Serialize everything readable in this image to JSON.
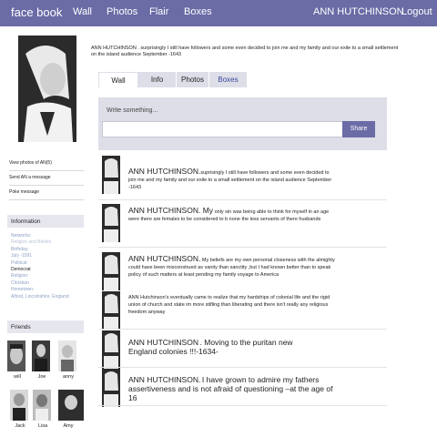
{
  "nav": {
    "brand": "face book",
    "wall": "Wall",
    "photos": "Photos",
    "flair": "Flair",
    "boxes": "Boxes",
    "user": "ANN HUTCHINSON",
    "logout": "Logout"
  },
  "header_text": "ANN HUTCHINSON . surprisingly I still have followers and some even decided to join me and my family and our exile to a small settlement  on the island  audience  September -1643",
  "tabs": [
    "Wall",
    "Info",
    "Photos",
    "Boxes"
  ],
  "composer": {
    "placeholder": "Write something...",
    "share": "Share"
  },
  "left_links": [
    "View photos of AN(5)",
    "Send AN a message",
    "Poke message"
  ],
  "info": {
    "title": "Information",
    "lines": [
      "Networks:",
      "Religion and Beliefs",
      "Birthday:",
      "July -1591",
      "Political:",
      "Democrat",
      "Religion:",
      "Christian",
      "Hometown:",
      "Alford, Lincolnshire, England"
    ]
  },
  "friends": {
    "title": "Friends",
    "names": [
      "will",
      "Joe",
      "anny",
      "Jack",
      "Lisa",
      "Amy"
    ]
  },
  "posts": [
    {
      "name": "ANN HUTCHINSON.",
      "text": "suprisingly I still have followers and some even decided to join me and my family and our exile to a small settlement  on the island  audience  September -1643"
    },
    {
      "name": "ANN HUTCHINSON. My",
      "text": "only sin was being able to think for myself in an age  were there are females to be considered to b none the less servants of there husbands"
    },
    {
      "name": "ANN HUTCHINSON.",
      "text": "My beliefs are my own personal closeness with the almighty could have been misconstrued as vanity than sanctity ,but I had known better than to speak  policy of such matters at least pending my family voyage to America"
    },
    {
      "name": "",
      "text": "ANN Hutchinson's eventually came to realize that my hardships of colonial life and the rigid union of church and state im more stifling than liberating and there isn't really any religious freedom anyway"
    },
    {
      "name": "ANN HUTCHINSON",
      "text": ". Moving to the puritan new England colonies !!!-1634-"
    },
    {
      "name": "ANN HUTCHINSON.",
      "text": "I have grown to admire my fathers assertiveness and is not afraid of questioning –at the age of 16"
    }
  ],
  "colors": {
    "nav_bg": "#6b6ba6",
    "tab_bg": "#dddee8",
    "link": "#8e9fc4"
  }
}
